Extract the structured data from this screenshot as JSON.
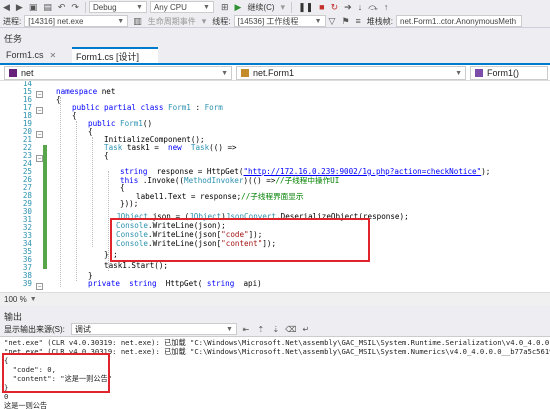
{
  "toolbar": {
    "config": "Debug",
    "platform": "Any CPU",
    "continue_label": "继续(C)",
    "process_label": "进程:",
    "process_value": "[14316] net.exe",
    "lifecycle_label": "生命周期事件",
    "thread_label": "线程:",
    "thread_value": "[14536] 工作线程",
    "stack_label": "堆栈帧:",
    "stack_value": "net.Form1..ctor.AnonymousMeth"
  },
  "tasks_label": "任务",
  "tabs": [
    {
      "label": "Form1.cs",
      "active": false
    },
    {
      "label": "Form1.cs [设计]",
      "active": true
    }
  ],
  "navbar": {
    "project": "net",
    "class": "net.Form1",
    "member": "Form1()"
  },
  "editor": {
    "line_numbers": [
      "14",
      "15",
      "16",
      "17",
      "18",
      "19",
      "20",
      "21",
      "22",
      "23",
      "24",
      "25",
      "26",
      "27",
      "28",
      "29",
      "30",
      "31",
      "32",
      "33",
      "34",
      "35",
      "36",
      "37",
      "38",
      "39"
    ]
  },
  "zoom": "100 %",
  "output": {
    "title": "输出",
    "show_label": "显示输出来源(S):",
    "source": "调试",
    "lines": [
      "\"net.exe\" (CLR v4.0.30319: net.exe): 已加载 \"C:\\Windows\\Microsoft.Net\\assembly\\GAC_MSIL\\System.Runtime.Serialization\\v4.0_4.0.0.0__b77a5c561934",
      "\"net.exe\" (CLR v4.0.30319: net.exe): 已加载 \"C:\\Windows\\Microsoft.Net\\assembly\\GAC_MSIL\\System.Numerics\\v4.0_4.0.0.0__b77a5c561934e089\\System.Nu",
      "{",
      "  \"code\": 0,",
      "  \"content\": \"这是一则公告\"",
      "}",
      "0",
      "这是一则公告"
    ]
  },
  "colors": {
    "accent": "#007acc",
    "highlight_box": "#e0242b",
    "change_bar": "#57a64a"
  }
}
